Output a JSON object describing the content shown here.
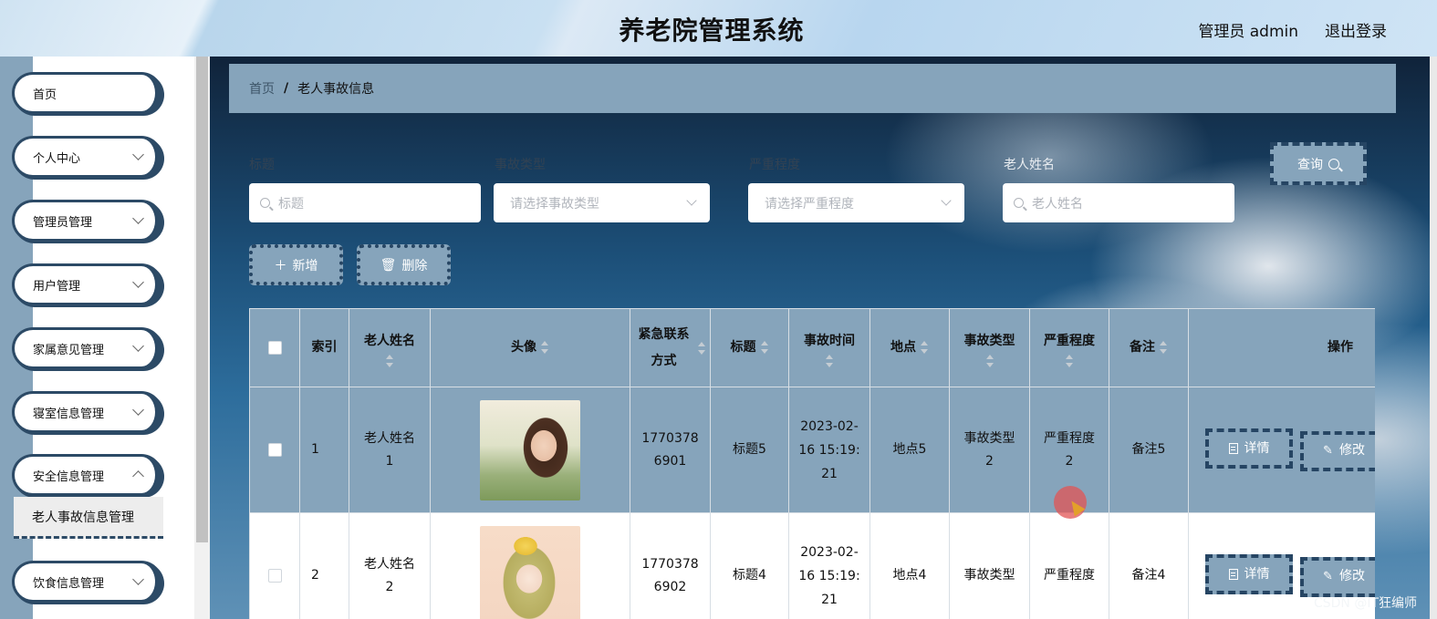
{
  "header": {
    "title": "养老院管理系统",
    "user": "管理员 admin",
    "logout": "退出登录"
  },
  "sidebar": {
    "items": [
      {
        "label": "首页"
      },
      {
        "label": "个人中心"
      },
      {
        "label": "管理员管理"
      },
      {
        "label": "用户管理"
      },
      {
        "label": "家属意见管理"
      },
      {
        "label": "寝室信息管理"
      },
      {
        "label": "安全信息管理"
      },
      {
        "label": "饮食信息管理"
      }
    ],
    "active_sub": "老人事故信息管理"
  },
  "breadcrumb": {
    "home": "首页",
    "separator": "/",
    "current": "老人事故信息"
  },
  "filters": {
    "title_label": "标题",
    "title_placeholder": "标题",
    "type_label": "事故类型",
    "type_placeholder": "请选择事故类型",
    "severity_label": "严重程度",
    "severity_placeholder": "请选择严重程度",
    "name_label": "老人姓名",
    "name_placeholder": "老人姓名",
    "query_button": "查询"
  },
  "actions": {
    "add": "新增",
    "delete": "删除"
  },
  "table": {
    "headers": {
      "index": "索引",
      "name": "老人姓名",
      "avatar": "头像",
      "contact": "紧急联系方式",
      "title": "标题",
      "time": "事故时间",
      "location": "地点",
      "type": "事故类型",
      "severity": "严重程度",
      "remark": "备注",
      "ops": "操作"
    },
    "rows": [
      {
        "index": "1",
        "name": "老人姓名1",
        "contact": "17703786901",
        "title": "标题5",
        "time": "2023-02-16 15:19:21",
        "location": "地点5",
        "type": "事故类型2",
        "severity": "严重程度2",
        "remark": "备注5",
        "detail": "详情",
        "edit": "修改"
      },
      {
        "index": "2",
        "name": "老人姓名2",
        "contact": "17703786902",
        "title": "标题4",
        "time": "2023-02-16 15:19:21",
        "location": "地点4",
        "type": "事故类型",
        "severity": "严重程度",
        "remark": "备注4",
        "detail": "详情",
        "edit": "修改"
      }
    ]
  },
  "watermark": "CSDN @IT狂编师",
  "colors": {
    "panel": "#86a4bb",
    "accent_dark": "#264563",
    "cursor_highlight": "#e25454"
  }
}
